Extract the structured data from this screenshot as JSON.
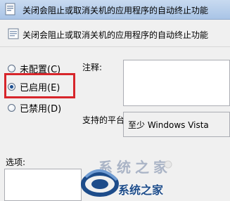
{
  "window": {
    "title": "关闭会阻止或取消关机的应用程序的自动终止功能"
  },
  "header": {
    "policy_name": "关闭会阻止或取消关机的应用程序的自动终止功能"
  },
  "state_options": [
    {
      "label": "未配置(C)",
      "checked": false
    },
    {
      "label": "已启用(E)",
      "checked": true
    },
    {
      "label": "已禁用(D)",
      "checked": false
    }
  ],
  "comment": {
    "label": "注释:",
    "value": ""
  },
  "platform": {
    "label": "支持的平台:",
    "value": "至少 Windows Vista"
  },
  "options": {
    "label": "选项:"
  },
  "watermark": {
    "text": "系统之家",
    "ghost_text": "系统之家"
  },
  "colors": {
    "highlight_border": "#d7262b",
    "titlebar": "#b7cfec",
    "watermark_blue": "#1d4c8a"
  }
}
